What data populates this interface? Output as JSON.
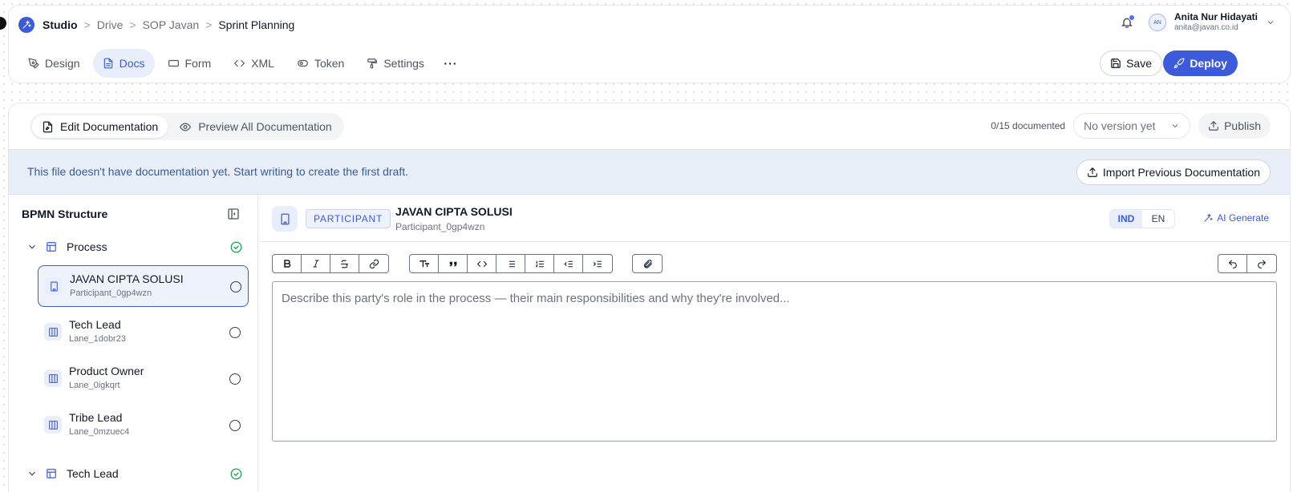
{
  "breadcrumb": {
    "items": [
      "Studio",
      "Drive",
      "SOP Javan",
      "Sprint Planning"
    ],
    "separator": ">"
  },
  "user": {
    "initials": "AN",
    "name": "Anita Nur Hidayati",
    "email": "anita@javan.co.id"
  },
  "tabs": [
    {
      "label": "Design",
      "icon": "pen-tool-icon"
    },
    {
      "label": "Docs",
      "icon": "document-icon",
      "active": true
    },
    {
      "label": "Form",
      "icon": "form-icon"
    },
    {
      "label": "XML",
      "icon": "code-icon"
    },
    {
      "label": "Token",
      "icon": "token-icon"
    },
    {
      "label": "Settings",
      "icon": "paint-roller-icon"
    }
  ],
  "more_label": "···",
  "actions": {
    "save_label": "Save",
    "deploy_label": "Deploy"
  },
  "doc_toolbar": {
    "edit_label": "Edit Documentation",
    "preview_label": "Preview All Documentation",
    "count_text": "0/15 documented",
    "version_value": "No version yet",
    "publish_label": "Publish"
  },
  "notice": {
    "text": "This file doesn't have documentation yet. Start writing to create the first draft.",
    "import_label": "Import Previous Documentation"
  },
  "sidebar": {
    "title": "BPMN Structure",
    "groups": [
      {
        "label": "Process",
        "items": [
          {
            "name": "JAVAN CIPTA SOLUSI",
            "id": "Participant_0gp4wzn",
            "active": true
          },
          {
            "name": "Tech Lead",
            "id": "Lane_1dobr23"
          },
          {
            "name": "Product Owner",
            "id": "Lane_0igkqrt"
          },
          {
            "name": "Tribe Lead",
            "id": "Lane_0mzuec4"
          }
        ]
      },
      {
        "label": "Tech Lead",
        "items": []
      }
    ]
  },
  "editor": {
    "badge": "PARTICIPANT",
    "title": "JAVAN CIPTA SOLUSI",
    "subtitle": "Participant_0gp4wzn",
    "lang_options": [
      "IND",
      "EN"
    ],
    "lang_selected": "IND",
    "ai_label": "AI Generate",
    "placeholder": "Describe this party's role in the process — their main responsibilities and why they're involved..."
  },
  "colors": {
    "accent": "#3b5bdb",
    "notice_bg": "#e9eff8",
    "success": "#16a34a"
  }
}
